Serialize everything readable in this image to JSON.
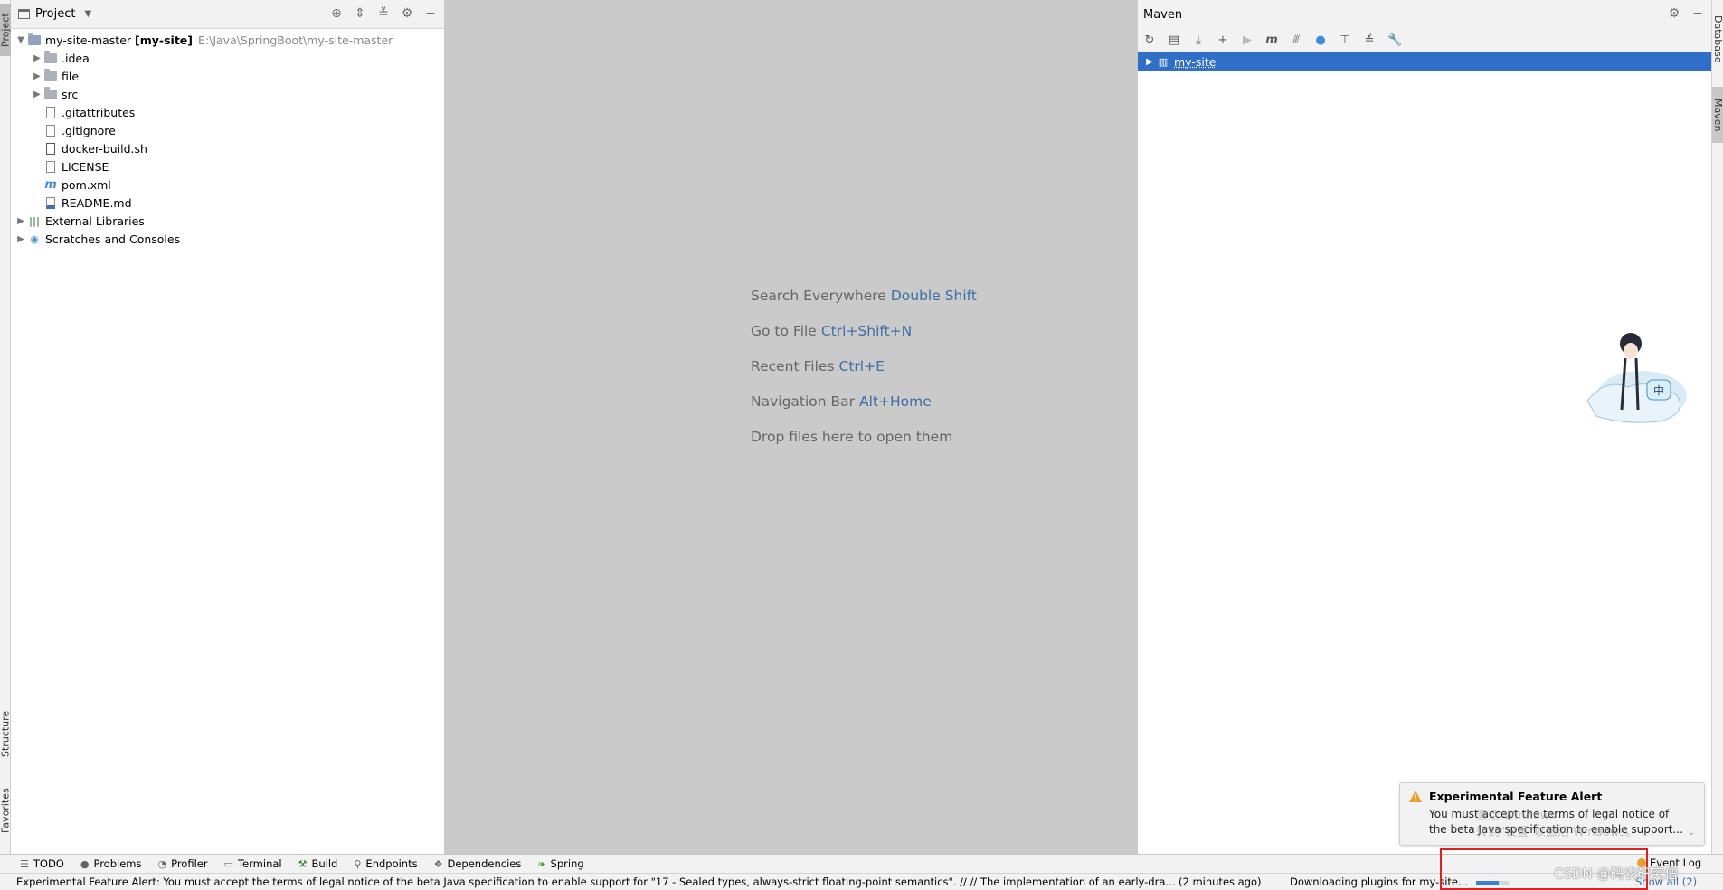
{
  "left_stripe": {
    "project_tab": "Project",
    "structure_tab": "Structure",
    "favorites_tab": "Favorites"
  },
  "right_stripe": {
    "database_tab": "Database",
    "maven_tab": "Maven"
  },
  "project_panel": {
    "title": "Project",
    "tree": {
      "root": {
        "name": "my-site-master",
        "module": "[my-site]",
        "path": "E:\\Java\\SpringBoot\\my-site-master"
      },
      "items": [
        {
          "label": ".idea"
        },
        {
          "label": "file"
        },
        {
          "label": "src"
        },
        {
          "label": ".gitattributes"
        },
        {
          "label": ".gitignore"
        },
        {
          "label": "docker-build.sh"
        },
        {
          "label": "LICENSE"
        },
        {
          "label": "pom.xml"
        },
        {
          "label": "README.md"
        }
      ],
      "external_libraries": "External Libraries",
      "scratches": "Scratches and Consoles"
    }
  },
  "editor": {
    "hints": [
      {
        "text": "Search Everywhere",
        "key": "Double Shift"
      },
      {
        "text": "Go to File",
        "key": "Ctrl+Shift+N"
      },
      {
        "text": "Recent Files",
        "key": "Ctrl+E"
      },
      {
        "text": "Navigation Bar",
        "key": "Alt+Home"
      },
      {
        "text": "Drop files here to open them",
        "key": ""
      }
    ]
  },
  "maven_panel": {
    "title": "Maven",
    "project": "my-site"
  },
  "notification": {
    "title": "Experimental Feature Alert",
    "line1": "You must accept the terms of legal notice of",
    "line2": "the beta Java specification to enable support...",
    "watermark1": "激活 Windows",
    "watermark2": "转到\"设置\"以激活 Windows。"
  },
  "tool_windows": {
    "todo": "TODO",
    "problems": "Problems",
    "profiler": "Profiler",
    "terminal": "Terminal",
    "build": "Build",
    "endpoints": "Endpoints",
    "dependencies": "Dependencies",
    "spring": "Spring",
    "event_log": "Event Log"
  },
  "status_bar": {
    "message": "Experimental Feature Alert: You must accept the terms of legal notice of the beta Java specification to enable support for \"17 - Sealed types, always-strict floating-point semantics\". // // The implementation of an early-dra... (2 minutes ago)",
    "download": "Downloading plugins for my-site...",
    "show_all": "Show all (2)",
    "progress": 0.7
  },
  "watermark": "CSDN @码农研究僧",
  "colors": {
    "selection": "#2f6fc7",
    "link": "#3d6ea8",
    "highlight_box": "#e02020"
  }
}
